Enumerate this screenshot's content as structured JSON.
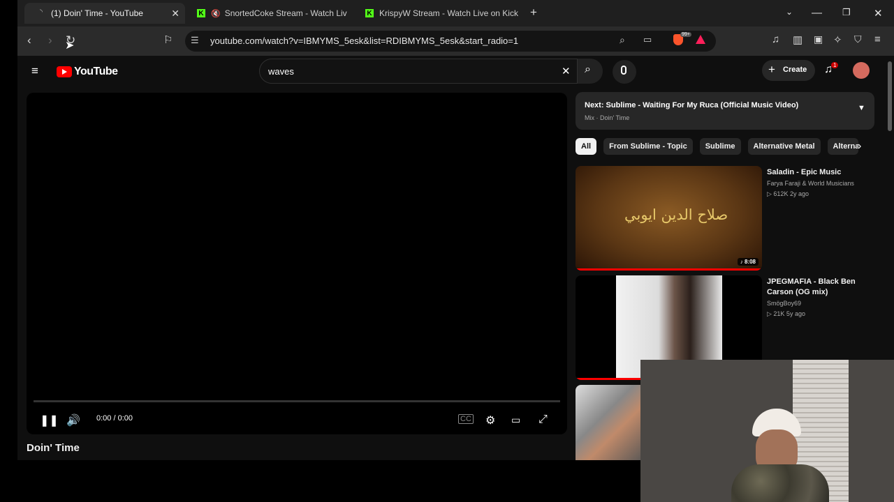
{
  "browser": {
    "tabs": [
      {
        "title": "(1) Doin' Time - YouTube",
        "active": true
      },
      {
        "title": "SnortedCoke Stream - Watch Live",
        "active": false
      },
      {
        "title": "KrispyW Stream - Watch Live on Kick",
        "active": false
      }
    ],
    "kick_letter": "K",
    "url": "youtube.com/watch?v=IBMYMS_5esk&list=RDIBMYMS_5esk&start_radio=1",
    "extension_badge": "99+",
    "icons": {
      "back": "back-arrow-icon",
      "forward": "forward-arrow-icon",
      "reload": "reload-icon",
      "bookmark": "bookmark-icon",
      "site_info": "site-info-icon",
      "zoom": "zoom-icon",
      "cast": "cast-icon",
      "brave": "brave-shield-icon",
      "rewards": "brave-rewards-icon",
      "music": "media-icon",
      "sidebar": "sidebar-icon",
      "wallet": "wallet-icon",
      "leo": "leo-ai-icon",
      "vpn": "vpn-icon",
      "menu": "menu-icon"
    }
  },
  "youtube": {
    "logo_text": "YouTube",
    "search_value": "waves",
    "create_label": "Create",
    "notification_count": "1",
    "player": {
      "time": "0:00 / 0:00"
    },
    "video_title": "Doin' Time",
    "next": {
      "title": "Next: Sublime - Waiting For My Ruca (Official Music Video)",
      "subtitle": "Mix · Doin' Time"
    },
    "chips": [
      "All",
      "From Sublime - Topic",
      "Sublime",
      "Alternative Metal",
      "Alterna"
    ],
    "recommendations": [
      {
        "title": "Saladin - Epic Music",
        "channel": "Farya Faraji & World Musicians",
        "stats": "▷ 612K   2y ago",
        "duration": "♪ 8:08",
        "thumb_text": "صلاح الدين ايوبي"
      },
      {
        "title": "JPEGMAFIA - Black Ben Carson (OG mix)",
        "channel": "SmögBoy69",
        "stats": "▷ 21K   5y ago"
      }
    ],
    "colors": {
      "brand_red": "#ff0000",
      "background": "#0f0f0f",
      "chip_bg": "#272727"
    }
  }
}
